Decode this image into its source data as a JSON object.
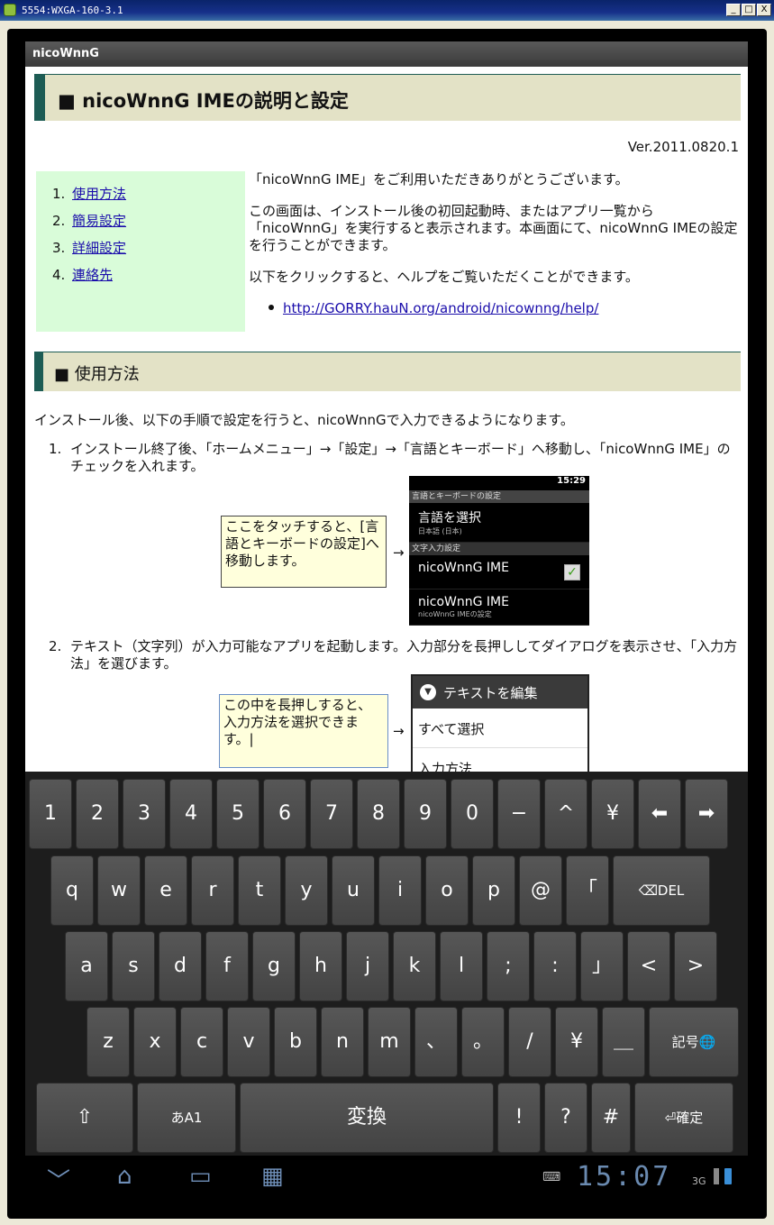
{
  "window": {
    "title": "5554:WXGA-160-3.1",
    "btn_min": "_",
    "btn_max": "□",
    "btn_close": "X"
  },
  "app": {
    "title": "nicoWnnG"
  },
  "page": {
    "heading": "■ nicoWnnG IMEの説明と設定",
    "version": "Ver.2011.0820.1",
    "toc": [
      {
        "num": "1.",
        "label": "使用方法"
      },
      {
        "num": "2.",
        "label": "簡易設定"
      },
      {
        "num": "3.",
        "label": "詳細設定"
      },
      {
        "num": "4.",
        "label": "連絡先"
      }
    ],
    "intro_1": "「nicoWnnG IME」をご利用いただきありがとうございます。",
    "intro_2": "この画面は、インストール後の初回起動時、またはアプリ一覧から「nicoWnnG」を実行すると表示されます。本画面にて、nicoWnnG IMEの設定を行うことができます。",
    "intro_3": "以下をクリックすると、ヘルプをご覧いただくことができます。",
    "help_link": "http://GORRY.hauN.org/android/nicownng/help/",
    "section_usage": "■ 使用方法",
    "usage_para": "インストール後、以下の手順で設定を行うと、nicoWnnGで入力できるようになります。",
    "step1_num": "1.",
    "step1": "インストール終了後、「ホームメニュー」→「設定」→「言語とキーボード」へ移動し、「nicoWnnG IME」のチェックを入れます。",
    "note1": "ここをタッチすると、[言語とキーボードの設定]へ移動します。",
    "arrow": "→",
    "shot1": {
      "status": "15:29",
      "header": "言語とキーボードの設定",
      "lang_title": "言語を選択",
      "lang_sub": "日本語 (日本)",
      "category": "文字入力設定",
      "ime1": "nicoWnnG IME",
      "ime2": "nicoWnnG IME",
      "ime2_sub": "nicoWnnG IMEの設定",
      "check": "✓"
    },
    "step2_num": "2.",
    "step2": "テキスト（文字列）が入力可能なアプリを起動します。入力部分を長押ししてダイアログを表示させ、「入力方法」を選びます。",
    "note2": "この中を長押しすると、入力方法を選択できます。|",
    "shot2": {
      "header": "テキストを編集",
      "item1": "すべて選択",
      "item2": "入力方法"
    }
  },
  "keyboard": {
    "row1": [
      "1",
      "2",
      "3",
      "4",
      "5",
      "6",
      "7",
      "8",
      "9",
      "0",
      "−",
      "^",
      "¥",
      "⬅",
      "➡"
    ],
    "row2": [
      "q",
      "w",
      "e",
      "r",
      "t",
      "y",
      "u",
      "i",
      "o",
      "p",
      "@",
      "「",
      "⌫DEL"
    ],
    "row3": [
      "a",
      "s",
      "d",
      "f",
      "g",
      "h",
      "j",
      "k",
      "l",
      ";",
      ":",
      "」",
      "<",
      ">"
    ],
    "row4": [
      "z",
      "x",
      "c",
      "v",
      "b",
      "n",
      "m",
      "、",
      "。",
      "/",
      "¥",
      "＿",
      "記号🌐"
    ],
    "row5": [
      "⇧",
      "あA1",
      "変換",
      "!",
      "?",
      "#",
      "⏎確定"
    ]
  },
  "navbar": {
    "back": "﹀",
    "home": "⌂",
    "recent": "▭",
    "keyboard": "▦",
    "clock": "15:07",
    "network": "3G",
    "kbd_icon": "⌨"
  },
  "colors": {
    "heading_bar": "#1d5c54",
    "heading_bg": "#e3e2c6",
    "toc_bg": "#d9fcd9",
    "note_bg": "#ffffdc"
  }
}
